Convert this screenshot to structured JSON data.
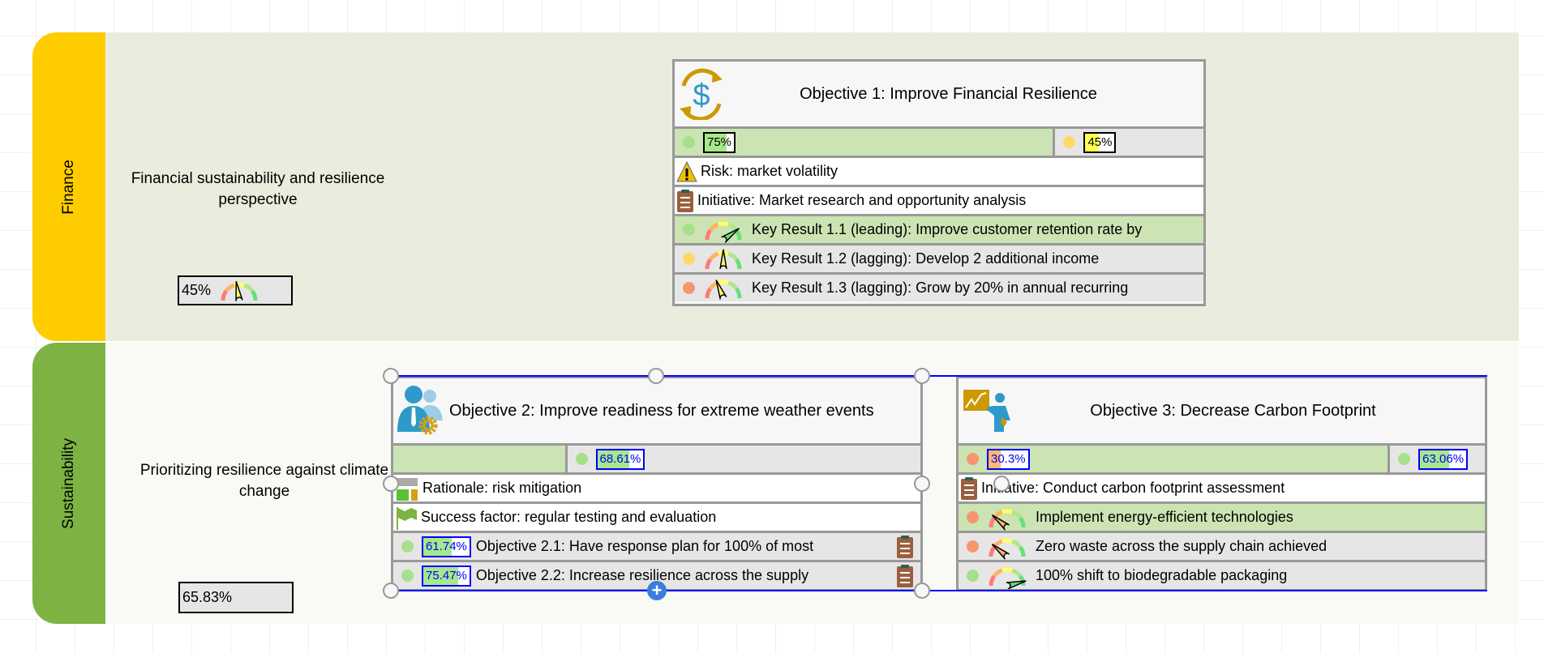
{
  "colors": {
    "finance": "#ffcc00",
    "sustainability": "#7cb342",
    "finance_bg": "#eaecdd",
    "sustain_bg": "#f9faf5",
    "status_green": "#a6e08a",
    "status_yellow": "#ffd966",
    "status_orange": "#f59670",
    "selection": "#0000ff"
  },
  "lanes": [
    {
      "label": "Finance",
      "description": "Financial sustainability and resilience perspective",
      "indicator": {
        "text": "45%",
        "gauge_value": 0.45,
        "gauge": true
      }
    },
    {
      "label": "Sustainability",
      "description": "Prioritizing resilience against climate change",
      "indicator": {
        "text": "65.83%",
        "gauge": false
      }
    }
  ],
  "objectives": [
    {
      "title": "Objective 1: Improve Financial Resilience",
      "icon": "dollar-cycle-icon",
      "progress": [
        {
          "status": "green",
          "value": "75%",
          "fill": 0.75,
          "fill_color": "#a6e88a",
          "style": "black",
          "bg": "green"
        },
        {
          "status": "yellow",
          "value": "45%",
          "fill": 0.45,
          "fill_color": "#ffff55",
          "style": "black",
          "bg": "gray"
        }
      ],
      "rows": [
        {
          "type": "text",
          "icon": "warning-icon",
          "text": "Risk: market volatility",
          "bg": "white"
        },
        {
          "type": "text",
          "icon": "clipboard-icon",
          "text": "Initiative: Market research and opportunity analysis",
          "bg": "white"
        },
        {
          "type": "kr",
          "status": "green",
          "gauge_value": 0.8,
          "text": "Key Result 1.1 (leading): Improve customer retention rate by",
          "bg": "green"
        },
        {
          "type": "kr",
          "status": "yellow",
          "gauge_value": 0.5,
          "text": "Key Result 1.2 (lagging): Develop 2 additional income",
          "bg": "gray"
        },
        {
          "type": "kr",
          "status": "orange",
          "gauge_value": 0.38,
          "text": "Key Result 1.3 (lagging): Grow by 20% in annual recurring",
          "bg": "gray"
        }
      ]
    },
    {
      "title": "Objective 2: Improve readiness for extreme weather events",
      "icon": "team-gear-icon",
      "progress": [
        {
          "empty": true,
          "bg": "green"
        },
        {
          "status": "green",
          "value": "68.61%",
          "fill": 0.6861,
          "fill_color": "#a6e88a",
          "style": "blue",
          "bg": "gray"
        }
      ],
      "rows": [
        {
          "type": "text",
          "icon": "rationale-icon",
          "text": "Rationale: risk mitigation",
          "bg": "white"
        },
        {
          "type": "text",
          "icon": "flag-icon",
          "text": "Success factor: regular testing and evaluation",
          "bg": "white"
        },
        {
          "type": "sub",
          "status": "green",
          "value": "61.74%",
          "fill": 0.6174,
          "text": "Objective 2.1: Have response plan for 100% of most",
          "bg": "gray"
        },
        {
          "type": "sub",
          "status": "green",
          "value": "75.47%",
          "fill": 0.7547,
          "text": "Objective 2.2: Increase resilience across the supply",
          "bg": "gray"
        }
      ]
    },
    {
      "title": "Objective 3: Decrease Carbon Footprint",
      "icon": "presenter-chart-icon",
      "progress": [
        {
          "status": "orange",
          "value": "30.3%",
          "fill": 0.303,
          "fill_color": "#ffb870",
          "style": "blue",
          "bg": "green"
        },
        {
          "status": "green",
          "value": "63.06%",
          "fill": 0.6306,
          "fill_color": "#a6e88a",
          "style": "blue",
          "bg": "gray"
        }
      ],
      "rows": [
        {
          "type": "text",
          "icon": "clipboard-icon",
          "text": "Initiative: Conduct carbon footprint assessment",
          "bg": "white"
        },
        {
          "type": "kr",
          "status": "orange",
          "gauge_value": 0.22,
          "text": "Implement energy-efficient technologies",
          "bg": "green"
        },
        {
          "type": "kr",
          "status": "orange",
          "gauge_value": 0.22,
          "text": "Zero waste across the supply chain achieved",
          "bg": "gray"
        },
        {
          "type": "kr",
          "status": "green",
          "gauge_value": 0.92,
          "text": "100% shift to biodegradable packaging",
          "bg": "gray"
        }
      ]
    }
  ]
}
